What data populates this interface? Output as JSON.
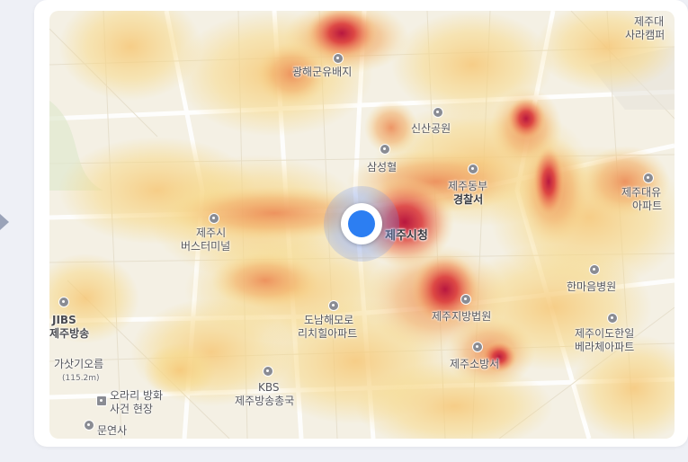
{
  "map": {
    "labels": {
      "gwanghae": "광해군유배지",
      "sinsan_park": "신산공원",
      "samseonghyeol": "삼성혈",
      "jeju_dongbu_1": "제주동부",
      "jeju_dongbu_2": "경찰서",
      "jeju_city_hall": "제주시청",
      "bus_terminal_1": "제주시",
      "bus_terminal_2": "버스터미널",
      "district_court": "제주지방법원",
      "fire_station": "제주소방서",
      "donam_1": "도남해모로",
      "donam_2": "리치힐아파트",
      "hanmaeum": "한마음병원",
      "idohanil_1": "제주이도한일",
      "idohanil_2": "베라체아파트",
      "jibs_1": "JIBS",
      "jibs_2": "제주방송",
      "gasitgi_1": "가삿기오름",
      "gasitgi_2": "(115.2m)",
      "orari_1": "오라리 방화",
      "orari_2": "사건 현장",
      "kbs_1": "KBS",
      "kbs_2": "제주방송총국",
      "munyeonsa": "문연사",
      "jeju_dae_1": "제주대유",
      "jeju_dae_2": "아파트",
      "top_right_1": "제주대",
      "top_right_2": "사라캠퍼"
    },
    "current_location_icon": "current-location-marker",
    "heat_colors": {
      "low": "#f7d98a",
      "mid": "#f0a868",
      "high": "#e0503a",
      "peak": "#c2204a"
    }
  }
}
